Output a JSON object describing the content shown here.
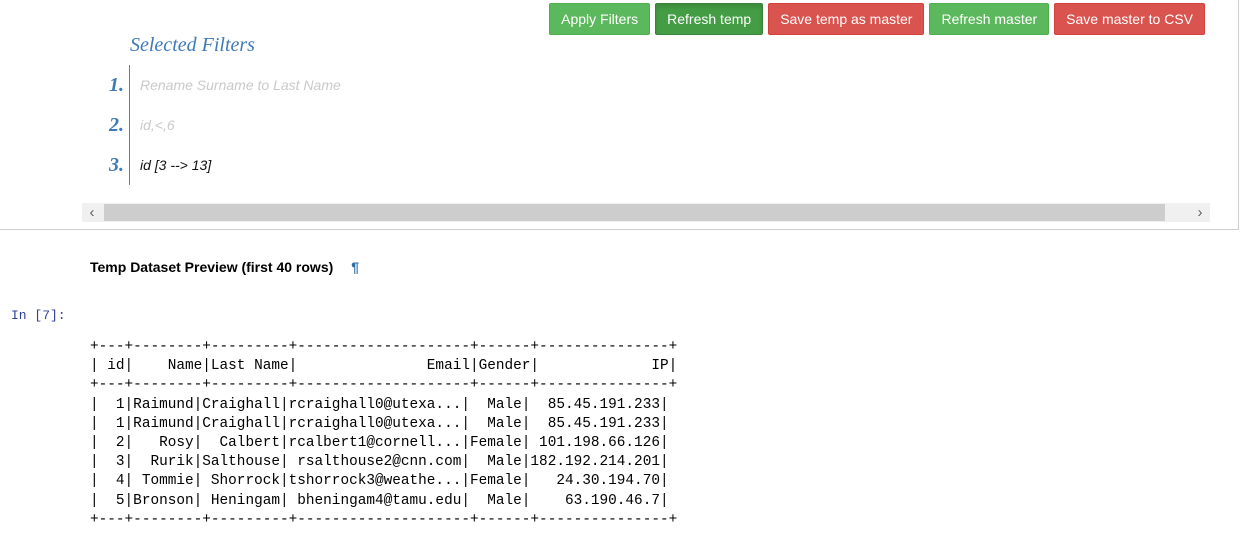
{
  "toolbar": {
    "apply_filters": "Apply Filters",
    "refresh_temp": "Refresh temp",
    "save_temp_as_master": "Save temp as master",
    "refresh_master": "Refresh master",
    "save_master_to_csv": "Save master to CSV"
  },
  "filters": {
    "title": "Selected Filters",
    "items": [
      {
        "num": "1.",
        "text": "Rename Surname to Last Name",
        "state": "faded"
      },
      {
        "num": "2.",
        "text": "id,<,6",
        "state": "faded"
      },
      {
        "num": "3.",
        "text": "id [3 --> 13]",
        "state": "active"
      }
    ]
  },
  "scrollbar": {
    "left_arrow": "‹",
    "right_arrow": "›"
  },
  "preview": {
    "heading": "Temp Dataset Preview (first 40 rows)",
    "anchor": "¶"
  },
  "cell": {
    "prompt": "In [7]:"
  },
  "table_lines": [
    "+---+--------+---------+--------------------+------+---------------+",
    "| id|    Name|Last Name|               Email|Gender|             IP|",
    "+---+--------+---------+--------------------+------+---------------+",
    "|  1|Raimund|Craighall|rcraighall0@utexa...|  Male|  85.45.191.233|",
    "|  1|Raimund|Craighall|rcraighall0@utexa...|  Male|  85.45.191.233|",
    "|  2|   Rosy|  Calbert|rcalbert1@cornell...|Female| 101.198.66.126|",
    "|  3|  Rurik|Salthouse| rsalthouse2@cnn.com|  Male|182.192.214.201|",
    "|  4| Tommie| Shorrock|tshorrock3@weathe...|Female|   24.30.194.70|",
    "|  5|Bronson| Heningam| bheningam4@tamu.edu|  Male|    63.190.46.7|",
    "+---+--------+---------+--------------------+------+---------------+"
  ],
  "colors": {
    "success": "#5cb85c",
    "success_active": "#449d44",
    "danger": "#d9534f",
    "filter_blue": "#3e7ab8"
  }
}
